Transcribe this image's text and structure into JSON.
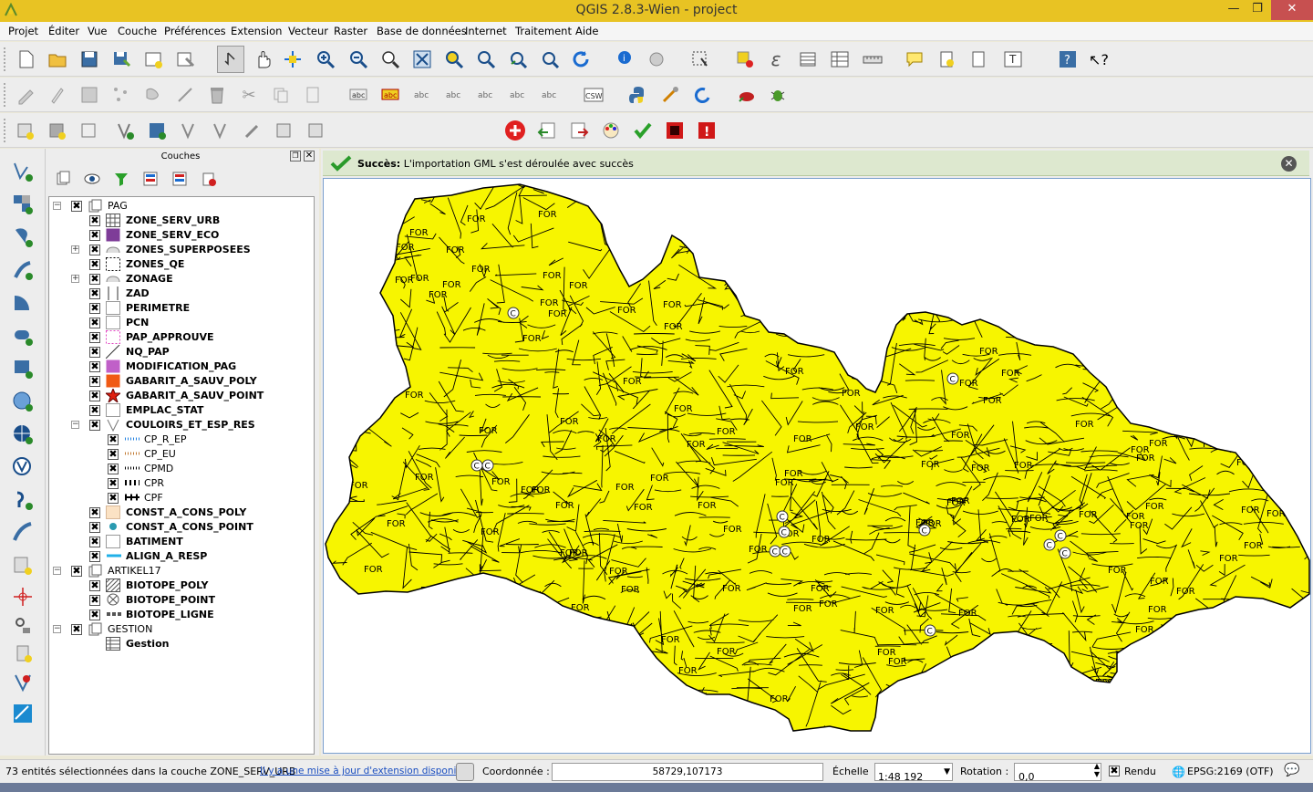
{
  "window": {
    "title": "QGIS 2.8.3-Wien - project"
  },
  "menu": [
    "Projet",
    "Éditer",
    "Vue",
    "Couche",
    "Préférences",
    "Extension",
    "Vecteur",
    "Raster",
    "Base de données",
    "Internet",
    "Traitement",
    "Aide"
  ],
  "layers_panel": {
    "title": "Couches"
  },
  "layers": [
    {
      "name": "PAG",
      "group": true,
      "level": 0
    },
    {
      "name": "ZONE_SERV_URB",
      "level": 1,
      "sym": "hatch"
    },
    {
      "name": "ZONE_SERV_ECO",
      "level": 1,
      "sym": "purple"
    },
    {
      "name": "ZONES_SUPERPOSEES",
      "level": 1,
      "sym": "cloud",
      "expand": true
    },
    {
      "name": "ZONES_QE",
      "level": 1,
      "sym": "dashbox"
    },
    {
      "name": "ZONAGE",
      "level": 1,
      "sym": "cloud",
      "expand": true
    },
    {
      "name": "ZAD",
      "level": 1,
      "sym": "bracket"
    },
    {
      "name": "PERIMETRE",
      "level": 1,
      "sym": "empty"
    },
    {
      "name": "PCN",
      "level": 1,
      "sym": "empty"
    },
    {
      "name": "PAP_APPROUVE",
      "level": 1,
      "sym": "pinkdash"
    },
    {
      "name": "NQ_PAP",
      "level": 1,
      "sym": "diag"
    },
    {
      "name": "MODIFICATION_PAG",
      "level": 1,
      "sym": "violet"
    },
    {
      "name": "GABARIT_A_SAUV_POLY",
      "level": 1,
      "sym": "orange"
    },
    {
      "name": "GABARIT_A_SAUV_POINT",
      "level": 1,
      "sym": "star"
    },
    {
      "name": "EMPLAC_STAT",
      "level": 1,
      "sym": "empty"
    },
    {
      "name": "COULOIRS_ET_ESP_RES",
      "level": 1,
      "sym": "vee",
      "expand": true
    },
    {
      "name": "CP_R_EP",
      "level": 2,
      "sym": "bluedots",
      "plain": true
    },
    {
      "name": "CP_EU",
      "level": 2,
      "sym": "browndots",
      "plain": true
    },
    {
      "name": "CPMD",
      "level": 2,
      "sym": "blackdots",
      "plain": true
    },
    {
      "name": "CPR",
      "level": 2,
      "sym": "bars",
      "plain": true
    },
    {
      "name": "CPF",
      "level": 2,
      "sym": "bars2",
      "plain": true
    },
    {
      "name": "CONST_A_CONS_POLY",
      "level": 1,
      "sym": "peach"
    },
    {
      "name": "CONST_A_CONS_POINT",
      "level": 1,
      "sym": "tealdot"
    },
    {
      "name": "BATIMENT",
      "level": 1,
      "sym": "empty"
    },
    {
      "name": "ALIGN_A_RESP",
      "level": 1,
      "sym": "cyanline"
    },
    {
      "name": "ARTIKEL17",
      "group": true,
      "level": 0
    },
    {
      "name": "BIOTOPE_POLY",
      "level": 1,
      "sym": "diaghatch"
    },
    {
      "name": "BIOTOPE_POINT",
      "level": 1,
      "sym": "xcircle"
    },
    {
      "name": "BIOTOPE_LIGNE",
      "level": 1,
      "sym": "dashline"
    },
    {
      "name": "GESTION",
      "group": true,
      "level": 0
    },
    {
      "name": "Gestion",
      "level": 1,
      "sym": "table",
      "nocb": true
    }
  ],
  "message": {
    "title": "Succès:",
    "text": "L'importation GML s'est déroulée avec succès"
  },
  "map": {
    "fill": "#f7f500",
    "label": "FOR",
    "marker": "C"
  },
  "status": {
    "selection": "73 entités sélectionnées dans la couche ZONE_SERV_URB",
    "update_link": "Il y a une mise à jour d'extension disponible",
    "coord_label": "Coordonnée :",
    "coord_value": "58729,107173",
    "scale_label": "Échelle",
    "scale_value": "1:48 192",
    "rotation_label": "Rotation :",
    "rotation_value": "0,0",
    "render_label": "Rendu",
    "crs": "EPSG:2169 (OTF)"
  }
}
